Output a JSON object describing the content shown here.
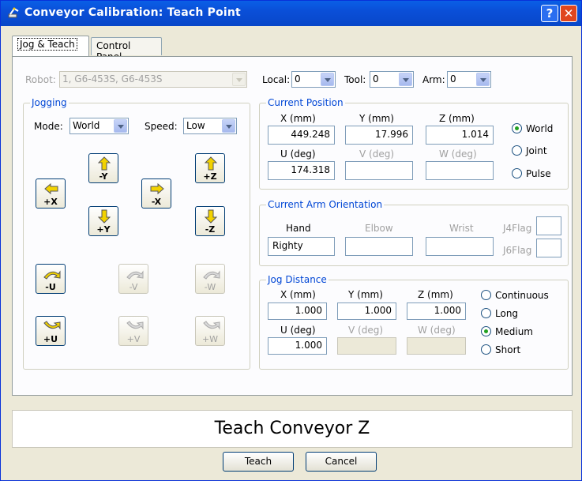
{
  "window": {
    "title": "Conveyor Calibration: Teach Point",
    "help_glyph": "?",
    "close_glyph": "✕"
  },
  "tabs": [
    {
      "label": "Jog & Teach"
    },
    {
      "label": "Control Panel"
    }
  ],
  "top": {
    "robot_label": "Robot:",
    "robot_value": "1, G6-453S, G6-453S",
    "local_label": "Local:",
    "local_value": "0",
    "tool_label": "Tool:",
    "tool_value": "0",
    "arm_label": "Arm:",
    "arm_value": "0"
  },
  "jogging": {
    "legend": "Jogging",
    "mode_label": "Mode:",
    "mode_value": "World",
    "speed_label": "Speed:",
    "speed_value": "Low",
    "buttons": {
      "plus_x": "+X",
      "minus_y": "-Y",
      "plus_y": "+Y",
      "minus_x": "-X",
      "plus_z": "+Z",
      "minus_z": "-Z",
      "minus_u": "-U",
      "minus_v": "-V",
      "minus_w": "-W",
      "plus_u": "+U",
      "plus_v": "+V",
      "plus_w": "+W"
    }
  },
  "current_position": {
    "legend": "Current Position",
    "x_label": "X (mm)",
    "y_label": "Y (mm)",
    "z_label": "Z (mm)",
    "x": "449.248",
    "y": "17.996",
    "z": "1.014",
    "u_label": "U (deg)",
    "v_label": "V (deg)",
    "w_label": "W (deg)",
    "u": "174.318",
    "v": "",
    "w": "",
    "modes": [
      {
        "label": "World",
        "selected": true
      },
      {
        "label": "Joint",
        "selected": false
      },
      {
        "label": "Pulse",
        "selected": false
      }
    ]
  },
  "arm_orientation": {
    "legend": "Current Arm Orientation",
    "hand_label": "Hand",
    "elbow_label": "Elbow",
    "wrist_label": "Wrist",
    "hand": "Righty",
    "elbow": "",
    "wrist": "",
    "j4flag_label": "J4Flag",
    "j6flag_label": "J6Flag"
  },
  "jog_distance": {
    "legend": "Jog Distance",
    "x_label": "X (mm)",
    "y_label": "Y (mm)",
    "z_label": "Z (mm)",
    "x": "1.000",
    "y": "1.000",
    "z": "1.000",
    "u_label": "U (deg)",
    "v_label": "V (deg)",
    "w_label": "W (deg)",
    "u": "1.000",
    "options": [
      {
        "label": "Continuous",
        "selected": false
      },
      {
        "label": "Long",
        "selected": false
      },
      {
        "label": "Medium",
        "selected": true
      },
      {
        "label": "Short",
        "selected": false
      }
    ]
  },
  "instruction": "Teach Conveyor Z",
  "buttons": {
    "teach": "Teach",
    "cancel": "Cancel"
  },
  "colors": {
    "title_bar": "#0a4fd8",
    "group_legend": "#0046d5",
    "selected_radio": "#21a121",
    "jog_icon_fill": "#f2d200"
  }
}
